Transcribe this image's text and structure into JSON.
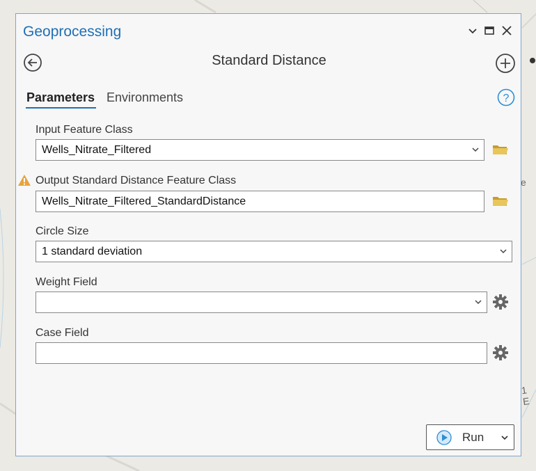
{
  "pane": {
    "title": "Geoprocessing",
    "tool_title": "Standard Distance",
    "tabs": [
      {
        "label": "Parameters",
        "active": true
      },
      {
        "label": "Environments",
        "active": false
      }
    ]
  },
  "params": {
    "input_label": "Input Feature Class",
    "input_value": "Wells_Nitrate_Filtered",
    "output_label": "Output Standard Distance Feature Class",
    "output_value": "Wells_Nitrate_Filtered_StandardDistance",
    "circle_label": "Circle Size",
    "circle_value": "1 standard deviation",
    "weight_label": "Weight Field",
    "weight_value": "",
    "case_label": "Case Field",
    "case_value": ""
  },
  "actions": {
    "run_label": "Run"
  },
  "map_fragments": {
    "right_e": "e",
    "right_1e": "1 E"
  },
  "icons": {
    "back": "back-arrow-icon",
    "add": "add-icon",
    "help": "help-icon",
    "browse": "folder-icon",
    "warning": "warning-icon",
    "settings": "gear-icon",
    "play": "play-icon"
  },
  "colors": {
    "accent": "#1f6fb5",
    "folder": "#d8b24a",
    "warning": "#e8a33c"
  }
}
